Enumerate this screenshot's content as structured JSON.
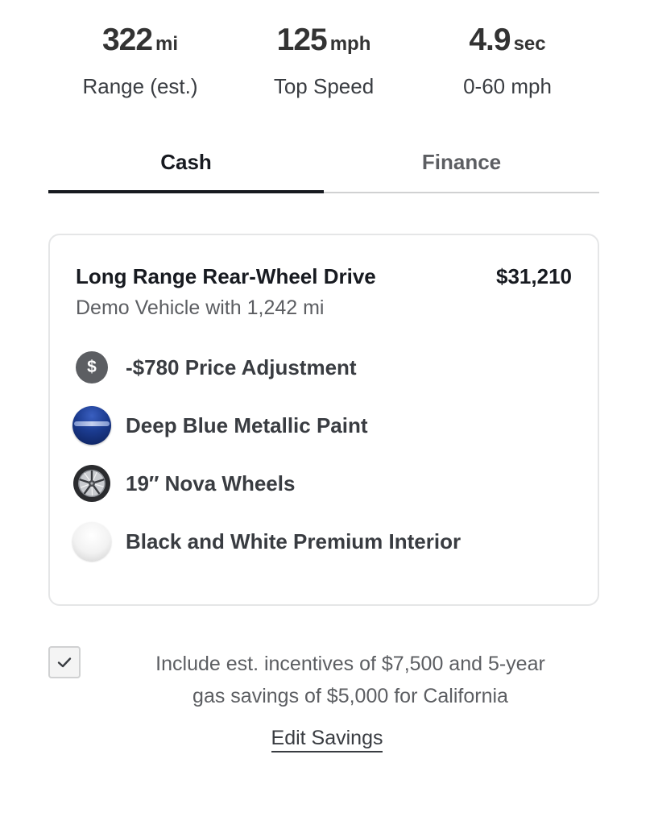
{
  "specs": [
    {
      "value": "322",
      "unit": "mi",
      "label": "Range (est.)"
    },
    {
      "value": "125",
      "unit": "mph",
      "label": "Top Speed"
    },
    {
      "value": "4.9",
      "unit": "sec",
      "label": "0-60 mph"
    }
  ],
  "tabs": [
    {
      "label": "Cash",
      "active": true
    },
    {
      "label": "Finance",
      "active": false
    }
  ],
  "summary": {
    "title": "Long Range Rear-Wheel Drive",
    "price": "$31,210",
    "subtitle": "Demo Vehicle with 1,242 mi",
    "options": [
      {
        "icon": "dollar-icon",
        "label": "-$780 Price Adjustment"
      },
      {
        "icon": "paint-swatch-icon",
        "label": "Deep Blue Metallic Paint"
      },
      {
        "icon": "wheel-icon",
        "label": "19′′ Nova Wheels"
      },
      {
        "icon": "interior-swatch-icon",
        "label": "Black and White Premium Interior"
      }
    ],
    "dollar_symbol": "$"
  },
  "incentives": {
    "checked": true,
    "line1": "Include est. incentives of $7,500 and 5-year",
    "line2": "gas savings of $5,000 for California"
  },
  "edit_savings_label": "Edit Savings",
  "colors": {
    "text_primary": "#171a20",
    "text_secondary": "#5c5e62",
    "paint_swatch": "#1b3b8f",
    "border": "#e5e6e7"
  }
}
